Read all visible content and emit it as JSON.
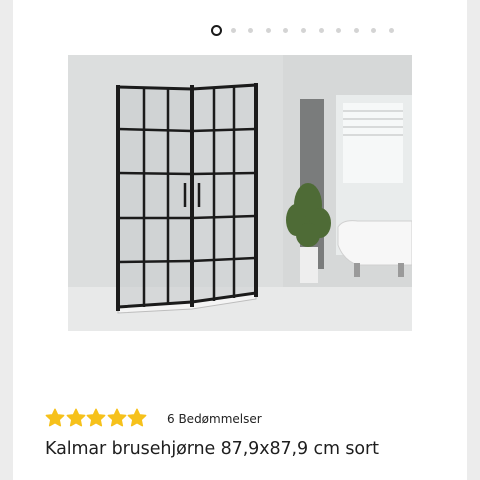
{
  "carousel": {
    "total": 11,
    "active": 0
  },
  "product": {
    "image_alt": "Kalmar brusehjørne sort",
    "rating_value": 5,
    "rating_max": 5,
    "rating_count_label": "6 Bedømmelser",
    "title": "Kalmar brusehjørne 87,9x87,9 cm sort"
  },
  "colors": {
    "star": "#f6c11b",
    "frame": "#1b1b1b",
    "dot_inactive": "#d4d4d4"
  },
  "icons": {
    "rating": "star-icon",
    "carousel": "dot-indicator"
  }
}
